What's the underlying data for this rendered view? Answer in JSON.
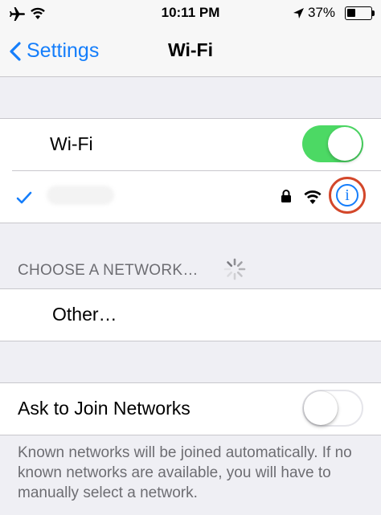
{
  "status_bar": {
    "time": "10:11 PM",
    "battery_percent": "37%",
    "battery_level": 0.37,
    "icons": [
      "airplane-icon",
      "wifi-signal-icon",
      "location-arrow-icon",
      "battery-icon"
    ]
  },
  "nav": {
    "back_label": "Settings",
    "title": "Wi-Fi"
  },
  "wifi_section": {
    "label": "Wi-Fi",
    "toggle_on": true,
    "connected_network": {
      "name_hidden": true,
      "icons": [
        "checkmark-icon",
        "lock-icon",
        "wifi-signal-icon",
        "info-icon"
      ]
    }
  },
  "choose_section": {
    "header": "CHOOSE A NETWORK…",
    "other_label": "Other…"
  },
  "ask_section": {
    "label": "Ask to Join Networks",
    "toggle_on": false,
    "footer": "Known networks will be joined automatically. If no known networks are available, you will have to manually select a network."
  },
  "colors": {
    "accent": "#157efb",
    "toggle_on": "#4cd964",
    "highlight_ring": "#d3472a",
    "background": "#efeff4"
  }
}
